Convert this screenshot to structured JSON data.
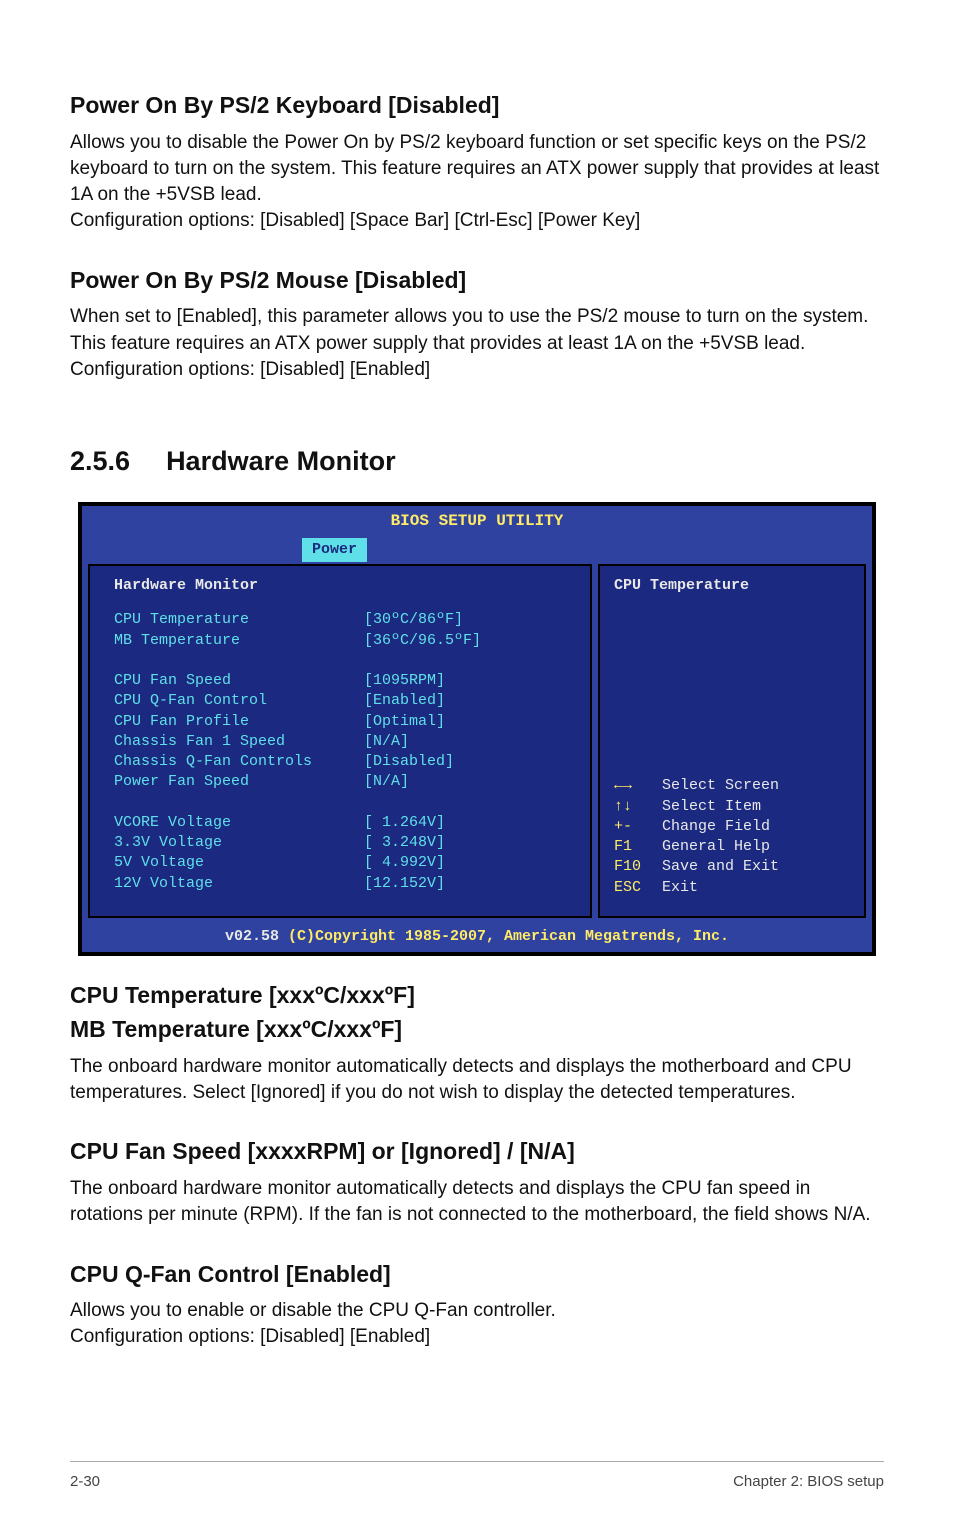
{
  "section_a": {
    "heading": "Power On By PS/2 Keyboard [Disabled]",
    "para": "Allows you to disable the Power On by PS/2 keyboard function or set specific keys on the PS/2 keyboard to turn on the system. This feature requires an ATX power supply that provides at least 1A on the +5VSB lead.\nConfiguration options: [Disabled] [Space Bar] [Ctrl-Esc] [Power Key]"
  },
  "section_b": {
    "heading": "Power On By PS/2 Mouse [Disabled]",
    "para": "When set to [Enabled], this parameter allows you to use the PS/2 mouse to turn on the system. This feature requires an ATX power supply that provides at least 1A on the +5VSB lead. Configuration options: [Disabled] [Enabled]"
  },
  "section_main": {
    "num": "2.5.6",
    "title": "Hardware Monitor"
  },
  "bios": {
    "header": "BIOS SETUP UTILITY",
    "tab": "Power",
    "left_title": "Hardware Monitor",
    "rows": [
      {
        "k": "CPU Temperature",
        "v": "[30ºC/86ºF]"
      },
      {
        "k": "MB Temperature",
        "v": "[36ºC/96.5ºF]"
      },
      {
        "k": "",
        "v": ""
      },
      {
        "k": "CPU Fan Speed",
        "v": "[1095RPM]"
      },
      {
        "k": "CPU Q-Fan Control",
        "v": "[Enabled]"
      },
      {
        "k": "CPU Fan Profile",
        "v": "[Optimal]"
      },
      {
        "k": "Chassis Fan 1 Speed",
        "v": "[N/A]"
      },
      {
        "k": "Chassis Q-Fan Controls",
        "v": "[Disabled]"
      },
      {
        "k": "Power Fan Speed",
        "v": "[N/A]"
      },
      {
        "k": "",
        "v": ""
      },
      {
        "k": "VCORE Voltage",
        "v": "[ 1.264V]"
      },
      {
        "k": "3.3V Voltage",
        "v": "[ 3.248V]"
      },
      {
        "k": "5V Voltage",
        "v": "[ 4.992V]"
      },
      {
        "k": "12V Voltage",
        "v": "[12.152V]"
      }
    ],
    "right_title": "CPU Temperature",
    "help": [
      {
        "key": "←→",
        "label": "Select Screen"
      },
      {
        "key": "↑↓",
        "label": "Select Item"
      },
      {
        "key": "+-",
        "label": "Change Field"
      },
      {
        "key": "F1",
        "label": "General Help"
      },
      {
        "key": "F10",
        "label": "Save and Exit"
      },
      {
        "key": "ESC",
        "label": "Exit"
      }
    ],
    "footer_left": "v02.58 ",
    "footer_right": "(C)Copyright 1985-2007, American Megatrends, Inc."
  },
  "section_c": {
    "heading1": "CPU Temperature [xxxºC/xxxºF]",
    "heading2": "MB Temperature [xxxºC/xxxºF]",
    "para": "The onboard hardware monitor automatically detects and displays the motherboard and CPU temperatures. Select [Ignored] if you do not wish to display the detected temperatures."
  },
  "section_d": {
    "heading": "CPU Fan Speed [xxxxRPM] or [Ignored] / [N/A]",
    "para": "The onboard hardware monitor automatically detects and displays the CPU fan speed in rotations per minute (RPM). If the fan is not connected to the motherboard, the field shows N/A."
  },
  "section_e": {
    "heading": "CPU Q-Fan Control [Enabled]",
    "para": "Allows you to enable or disable the CPU Q-Fan controller.\nConfiguration options: [Disabled] [Enabled]"
  },
  "footer": {
    "left": "2-30",
    "right": "Chapter 2: BIOS setup"
  }
}
